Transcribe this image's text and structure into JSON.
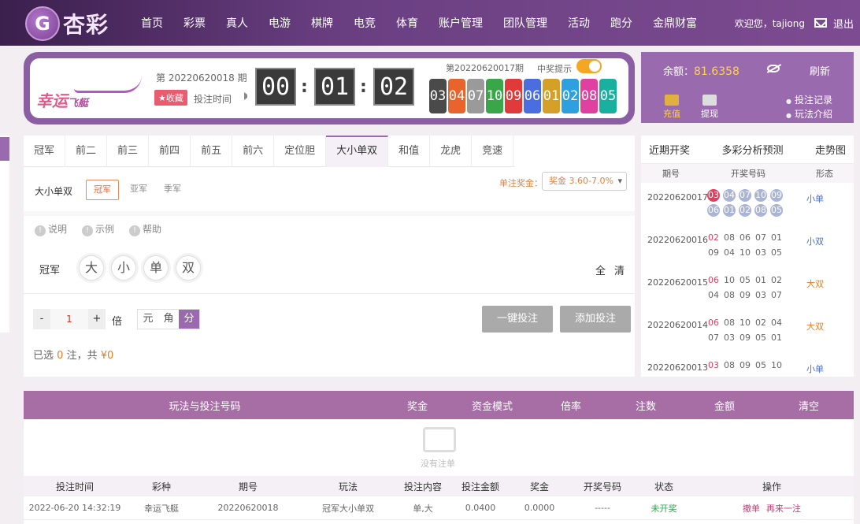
{
  "brand": {
    "logo_letter": "G",
    "name": "杏彩"
  },
  "nav": [
    "首页",
    "彩票",
    "真人",
    "电游",
    "棋牌",
    "电竞",
    "体育",
    "账户管理",
    "团队管理",
    "活动",
    "跑分",
    "金鼎财富"
  ],
  "user": {
    "greeting": "欢迎您，tajiong",
    "logout": "退出"
  },
  "lottery": {
    "name": "幸运",
    "name_sub": "飞艇",
    "current_issue": "第 20220620018 期",
    "favorite": "★收藏",
    "bet_time_label": "投注时间",
    "countdown": [
      "00",
      "01",
      "02"
    ],
    "prev_issue": "第20220620017期",
    "win_hint_label": "中奖提示",
    "win_hint_on": true,
    "balls": [
      {
        "n": "03",
        "color": "#4a4a4a"
      },
      {
        "n": "04",
        "color": "#e8642c"
      },
      {
        "n": "07",
        "color": "#9a9a9a"
      },
      {
        "n": "10",
        "color": "#3aa64a"
      },
      {
        "n": "09",
        "color": "#e03a3a"
      },
      {
        "n": "06",
        "color": "#4a6ee0"
      },
      {
        "n": "01",
        "color": "#d4a028"
      },
      {
        "n": "02",
        "color": "#2ea0e0"
      },
      {
        "n": "08",
        "color": "#e040a0"
      },
      {
        "n": "05",
        "color": "#1ab0a0"
      }
    ]
  },
  "account": {
    "balance_label": "余额：",
    "balance": "81.6358",
    "refresh": "刷新",
    "recharge": "充值",
    "withdraw": "提现",
    "bet_record": "投注记录",
    "play_intro": "玩法介绍"
  },
  "tabs": [
    "冠军",
    "前二",
    "前三",
    "前四",
    "前五",
    "前六",
    "定位胆",
    "大小单双",
    "和值",
    "龙虎",
    "竞速"
  ],
  "active_tab": "大小单双",
  "sub": {
    "label": "大小单双",
    "options": [
      "冠军",
      "亚军",
      "季军"
    ],
    "prize_label": "单注奖金：",
    "prize_value": "奖金 3.60-7.0%"
  },
  "info_links": [
    "说明",
    "示例",
    "帮助"
  ],
  "pick": {
    "position": "冠军",
    "options": [
      "大",
      "小",
      "单",
      "双"
    ],
    "all": "全",
    "clear": "清"
  },
  "bet": {
    "minus": "-",
    "multiple": "1",
    "plus": "+",
    "times": "倍",
    "units": [
      "元",
      "角",
      "分"
    ],
    "one_click": "一键投注",
    "add": "添加投注",
    "selected_prefix": "已选",
    "selected_count": "0",
    "selected_mid": "注，共",
    "selected_amount": "¥0"
  },
  "recent": {
    "tabs": [
      "近期开奖",
      "多彩分析预测",
      "走势图"
    ],
    "cols": [
      "期号",
      "开奖号码",
      "形态"
    ],
    "rows": [
      {
        "issue": "20220620017",
        "nums": [
          "03",
          "04",
          "07",
          "10",
          "09",
          "06",
          "01",
          "02",
          "08",
          "05"
        ],
        "form": "小单",
        "style": "ball"
      },
      {
        "issue": "20220620016",
        "nums": [
          "02",
          "08",
          "06",
          "07",
          "01",
          "09",
          "04",
          "10",
          "03",
          "05"
        ],
        "form": "小双",
        "style": "plain"
      },
      {
        "issue": "20220620015",
        "nums": [
          "06",
          "10",
          "05",
          "01",
          "02",
          "04",
          "08",
          "09",
          "03",
          "07"
        ],
        "form": "大双",
        "style": "plain"
      },
      {
        "issue": "20220620014",
        "nums": [
          "06",
          "08",
          "10",
          "02",
          "04",
          "07",
          "03",
          "09",
          "05",
          "01"
        ],
        "form": "大双",
        "style": "plain"
      },
      {
        "issue": "20220620013",
        "nums": [
          "03",
          "08",
          "09",
          "05",
          "10"
        ],
        "form": "小单",
        "style": "plain"
      }
    ]
  },
  "bet_table": {
    "cols": [
      "玩法与投注号码",
      "奖金",
      "资金模式",
      "倍率",
      "注数",
      "金额",
      "清空"
    ],
    "empty": "没有注单"
  },
  "history": {
    "cols": [
      "投注时间",
      "彩种",
      "期号",
      "玩法",
      "投注内容",
      "投注金额",
      "奖金",
      "开奖号码",
      "状态",
      "操作"
    ],
    "rows": [
      {
        "time": "2022-06-20 14:32:19",
        "lottery": "幸运飞艇",
        "issue": "20220620018",
        "play": "冠军大小单双",
        "content": "单,大",
        "amount": "0.0400",
        "prize": "0.0000",
        "draw": "-----",
        "status": "未开奖",
        "op1": "撤单",
        "op2": "再来一注"
      }
    ]
  }
}
